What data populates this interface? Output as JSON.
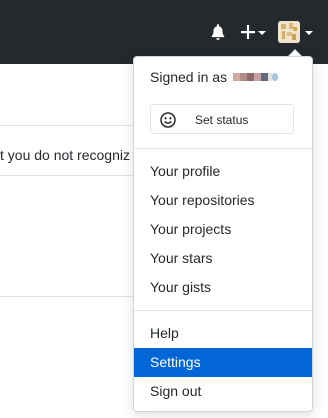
{
  "header": {
    "notifications_icon": "bell-icon",
    "create_icon": "plus-icon",
    "avatar_icon": "avatar"
  },
  "background": {
    "notice_text": "t you do not recogniz"
  },
  "dropdown": {
    "signed_in_label": "Signed in as",
    "status_button_label": "Set status",
    "status_icon": "smiley-icon",
    "profile_items": [
      {
        "label": "Your profile"
      },
      {
        "label": "Your repositories"
      },
      {
        "label": "Your projects"
      },
      {
        "label": "Your stars"
      },
      {
        "label": "Your gists"
      }
    ],
    "misc_items": [
      {
        "label": "Help"
      },
      {
        "label": "Settings",
        "active": true
      },
      {
        "label": "Sign out"
      }
    ]
  },
  "colors": {
    "header_bg": "#24292e",
    "active_bg": "#0366d6",
    "text": "#24292e"
  }
}
